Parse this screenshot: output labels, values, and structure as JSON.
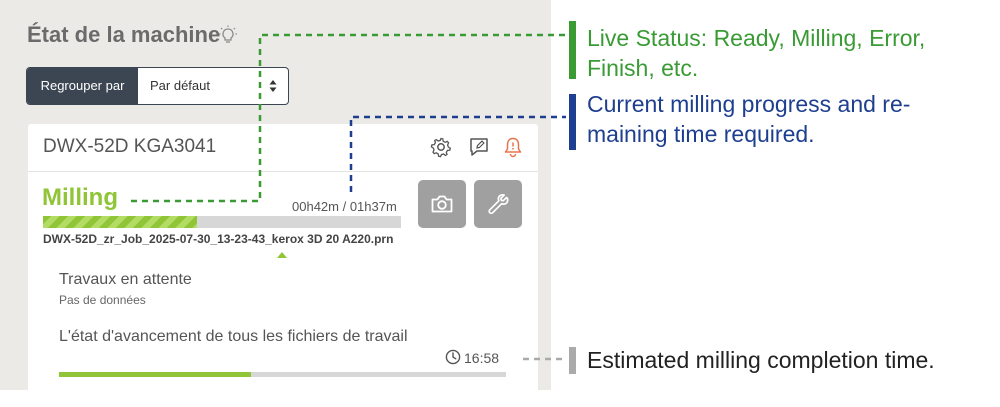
{
  "panel": {
    "title": "État de la machine",
    "group": {
      "label": "Regrouper par",
      "value": "Par défaut"
    }
  },
  "card": {
    "machine_name": "DWX-52D KGA3041",
    "status": "Milling",
    "elapsed_total": "00h42m / 01h37m",
    "progress": 0.43,
    "job_file": "DWX-52D_zr_Job_2025-07-30_13-23-43_kerox 3D 20 A220.prn",
    "pending_title": "Travaux en attente",
    "pending_sub": "Pas de données",
    "all_jobs_title": "L'état d'avancement de tous les fichiers de travail",
    "completion_time": "16:58",
    "all_jobs_progress": 0.43
  },
  "annotations": [
    {
      "text_lines": [
        "Live Status: Ready, Milling, Error,",
        "Finish, etc."
      ],
      "color": "#3a9b35"
    },
    {
      "text_lines": [
        "Current milling progress and re-",
        "maining time required."
      ],
      "color": "#1e3f8f"
    },
    {
      "text_lines": [
        "Estimated milling completion time."
      ],
      "color": "#222222"
    }
  ],
  "colors": {
    "accent_green": "#8fc536",
    "dark_button": "#3c4653",
    "alert_icon": "#e8734a"
  }
}
